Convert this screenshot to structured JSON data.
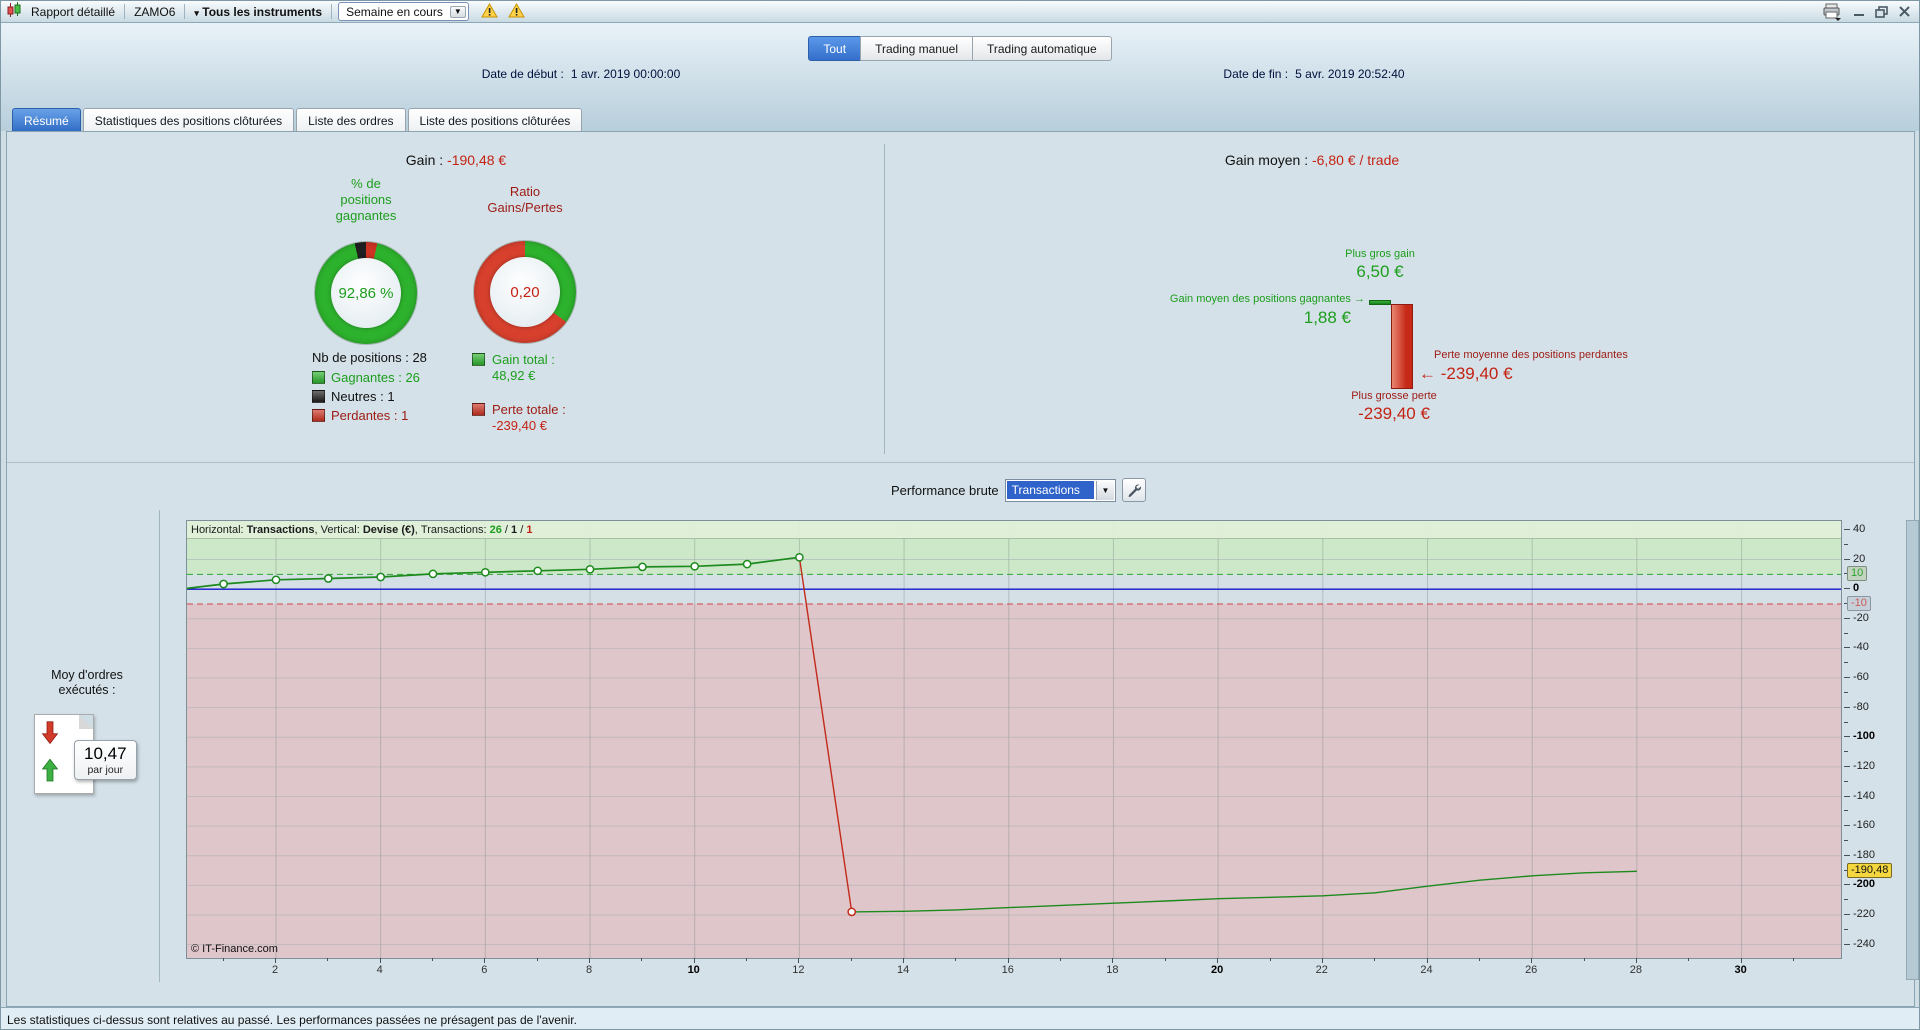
{
  "colors": {
    "green": "#2db22d",
    "green_text": "#1d9e1d",
    "red": "#cc3322",
    "red_text": "#c42314",
    "dark_red_text": "#9e1b15",
    "neutral_black": "#1f1f1f",
    "accent_blue": "#3f83db",
    "highlight_yellow": "#f4d73e"
  },
  "icons": {
    "caret_down_small": "▾",
    "caret_down": "▼",
    "arrow_right": "→",
    "arrow_left": "←"
  },
  "titlebar": {
    "report_label": "Rapport détaillé",
    "instrument": "ZAMO6",
    "all_instruments": "Tous les instruments",
    "period": "Semaine en cours"
  },
  "view_tabs": [
    {
      "label": "Tout",
      "active": true
    },
    {
      "label": "Trading manuel",
      "active": false
    },
    {
      "label": "Trading automatique",
      "active": false
    }
  ],
  "dates": {
    "start_label": "Date de début :",
    "start_value": "1 avr. 2019 00:00:00",
    "end_label": "Date de fin :",
    "end_value": "5 avr. 2019 20:52:40"
  },
  "section_tabs": [
    {
      "label": "Résumé",
      "active": true
    },
    {
      "label": "Statistiques des positions clôturées",
      "active": false
    },
    {
      "label": "Liste des ordres",
      "active": false
    },
    {
      "label": "Liste des positions clôturées",
      "active": false
    }
  ],
  "summary": {
    "gain_label": "Gain : ",
    "gain_value": "-190,48 €",
    "winning_donut": {
      "title_lines": [
        "% de",
        "positions",
        "gagnantes"
      ],
      "value": "92,86 %",
      "segments": [
        {
          "color": "#cc3322",
          "pct": 3.57
        },
        {
          "color": "#2db22d",
          "pct": 92.86
        },
        {
          "color": "#1f1f1f",
          "pct": 3.57
        }
      ]
    },
    "ratio_donut": {
      "title_lines": [
        "Ratio",
        "Gains/Pertes"
      ],
      "value": "0,20",
      "segments": [
        {
          "color": "#2db22d",
          "pct": 35
        },
        {
          "color": "#d8402e",
          "pct": 65
        }
      ]
    },
    "positions_count": "Nb de positions : 28",
    "breakdown": [
      {
        "label": "Gagnantes : 26",
        "color": "#2db22d",
        "text_color": "#1d9e1d"
      },
      {
        "label": "Neutres : 1",
        "color": "#1f1f1f",
        "text_color": "#111111"
      },
      {
        "label": "Perdantes : 1",
        "color": "#cc3322",
        "text_color": "#9e1b15"
      }
    ],
    "gain_total_label": "Gain total :",
    "gain_total_value": "48,92 €",
    "loss_total_label": "Perte totale :",
    "loss_total_value": "-239,40 €"
  },
  "average": {
    "heading_label": "Gain moyen : ",
    "heading_value": "-6,80 € / trade",
    "biggest_gain_label": "Plus gros gain",
    "biggest_gain_value": "6,50 €",
    "avg_win_label": "Gain moyen des positions gagnantes",
    "avg_win_value": "1,88 €",
    "avg_loss_label": "Perte moyenne des positions perdantes",
    "avg_loss_value": "-239,40 €",
    "biggest_loss_label": "Plus grosse perte",
    "biggest_loss_value": "-239,40 €"
  },
  "performance": {
    "label": "Performance brute",
    "dropdown_value": "Transactions",
    "header": {
      "h_label": "Horizontal: ",
      "h_value": "Transactions",
      "sep": ", ",
      "v_label": "Vertical: ",
      "v_value": "Devise (€)",
      "t_label": "Transactions: ",
      "win_count": "26",
      "slash": " / ",
      "neutral_count": "1",
      "loss_count": "1"
    },
    "orders": {
      "label_line1": "Moy d'ordres",
      "label_line2": "exécutés :",
      "value": "10,47",
      "unit": "par jour"
    },
    "copyright": "© IT-Finance.com",
    "y_axis": {
      "major_labels": [
        40,
        20,
        0,
        -20,
        -40,
        -60,
        -80,
        -100,
        -120,
        -140,
        -160,
        -180,
        -200,
        -220,
        -240
      ],
      "bold": [
        0,
        -100,
        -200
      ],
      "minor_step": 10,
      "upper_box": "10",
      "lower_box": "-10",
      "current_box": "-190,48"
    },
    "x_axis": {
      "labels": [
        2,
        4,
        6,
        8,
        10,
        12,
        14,
        16,
        18,
        20,
        22,
        24,
        26,
        28,
        30
      ],
      "bold": [
        10,
        20,
        30
      ]
    }
  },
  "status_bar": "Les statistiques ci-dessus sont relatives au passé. Les performances passées ne présagent pas de l'avenir.",
  "chart_data": {
    "type": "line",
    "title": "Performance brute",
    "xlabel": "Transactions",
    "ylabel": "Devise (€)",
    "xlim": [
      0.3,
      31.9
    ],
    "ylim": [
      -249,
      46
    ],
    "zero_line": 0,
    "upper_threshold": 10,
    "lower_threshold": -10,
    "grid_x_step": 2,
    "grid_y_step": 20,
    "start_point": {
      "x": 0.3,
      "y": 0.5
    },
    "x": [
      1,
      2,
      3,
      4,
      5,
      6,
      7,
      8,
      9,
      10,
      11,
      12,
      13,
      14,
      15,
      16,
      17,
      18,
      19,
      20,
      21,
      22,
      23,
      24,
      25,
      26,
      27,
      28
    ],
    "values": [
      3.5,
      6.3,
      7.2,
      8.2,
      10.3,
      11.4,
      12.4,
      13.4,
      15.0,
      15.4,
      16.9,
      21.5,
      -217.9,
      -217.5,
      -216.5,
      -215.0,
      -213.5,
      -212.0,
      -210.5,
      -209.0,
      -208.0,
      -207.0,
      -205.0,
      -200.5,
      -196.5,
      -193.5,
      -191.5,
      -190.48
    ],
    "final_value": -190.48,
    "legend_position": "none",
    "grid": true,
    "colors": {
      "line": "#1d8a1d",
      "drop": "#c22a1a",
      "zero_line": "#1515cc",
      "upper_zone": "#cde7c9",
      "lower_zone": "#dfc6cb",
      "mid_zone": "#d4dfe6"
    }
  }
}
